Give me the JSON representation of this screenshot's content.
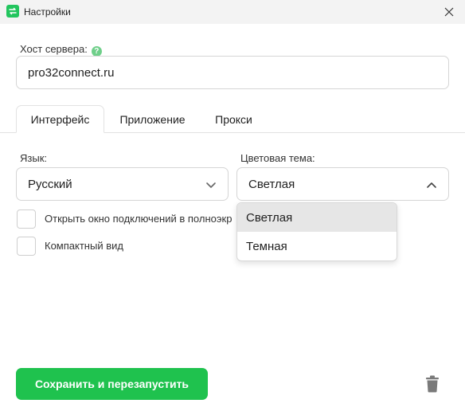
{
  "window": {
    "title": "Настройки",
    "close_icon": "close-icon",
    "app_icon": "app-icon"
  },
  "host": {
    "label": "Хост сервера:",
    "help_icon": "help-icon",
    "value": "pro32connect.ru"
  },
  "tabs": [
    {
      "label": "Интерфейс",
      "active": true
    },
    {
      "label": "Приложение",
      "active": false
    },
    {
      "label": "Прокси",
      "active": false
    }
  ],
  "language": {
    "label": "Язык:",
    "value": "Русский",
    "icon": "chevron-down-icon"
  },
  "theme": {
    "label": "Цветовая тема:",
    "value": "Светлая",
    "icon": "chevron-up-icon",
    "options": [
      "Светлая",
      "Темная"
    ],
    "selected_index": 0
  },
  "checkboxes": [
    {
      "label": "Открыть окно подключений в полноэкр",
      "checked": false
    },
    {
      "label": "Компактный вид",
      "checked": false
    }
  ],
  "footer": {
    "save_label": "Сохранить и перезапустить",
    "delete_icon": "trash-icon"
  },
  "colors": {
    "accent": "#1fc24e",
    "help": "#6fcf8a"
  }
}
